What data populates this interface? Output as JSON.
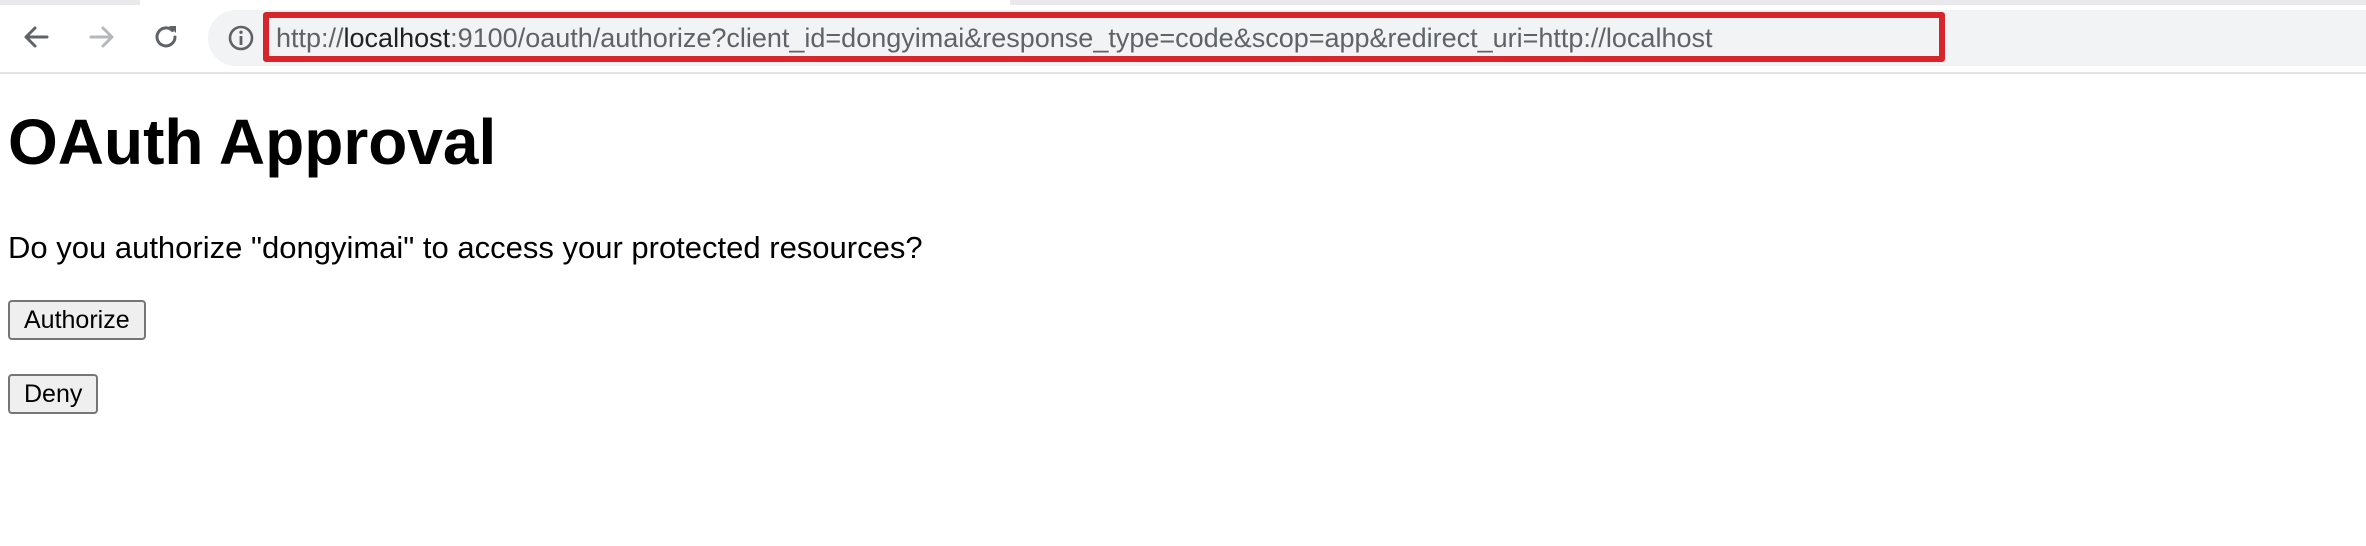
{
  "browser": {
    "url_prefix": "http://",
    "url_host": "localhost",
    "url_rest": ":9100/oauth/authorize?client_id=dongyimai&response_type=code&scop=app&redirect_uri=http://localhost",
    "highlight_color": "#d6262c",
    "icons": {
      "back": "arrow-left-icon",
      "forward": "arrow-right-icon",
      "reload": "reload-icon",
      "site_info": "info-icon"
    }
  },
  "page": {
    "title": "OAuth Approval",
    "prompt": "Do you authorize \"dongyimai\" to access your protected resources?",
    "authorize_label": "Authorize",
    "deny_label": "Deny"
  }
}
